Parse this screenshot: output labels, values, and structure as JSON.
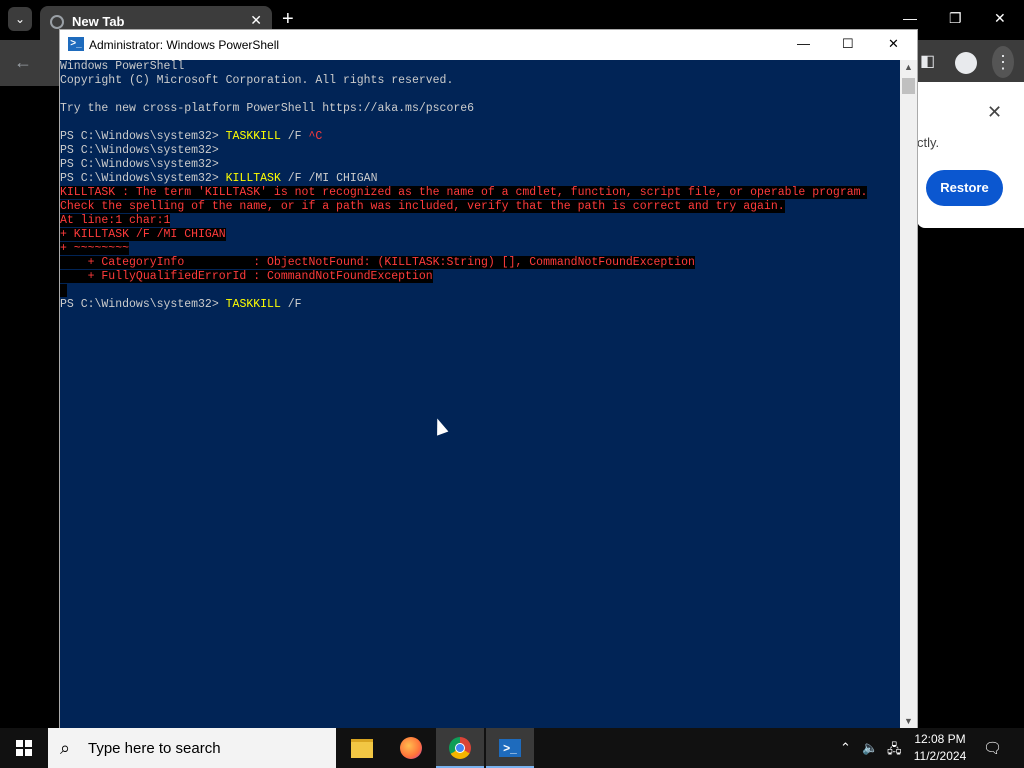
{
  "chrome": {
    "tab_title": "New Tab",
    "tab_close": "✕",
    "new_tab": "+",
    "minimize": "—",
    "restore": "❐",
    "close": "✕",
    "bubble_text": "ctly.",
    "bubble_close": "✕",
    "restore_button": "Restore"
  },
  "powershell": {
    "window_title": "Administrator: Windows PowerShell",
    "lines": [
      {
        "type": "plain",
        "text": "Windows PowerShell"
      },
      {
        "type": "plain",
        "text": "Copyright (C) Microsoft Corporation. All rights reserved."
      },
      {
        "type": "plain",
        "text": ""
      },
      {
        "type": "plain",
        "text": "Try the new cross-platform PowerShell https://aka.ms/pscore6"
      },
      {
        "type": "plain",
        "text": ""
      },
      {
        "type": "prompt",
        "prompt": "PS C:\\Windows\\system32> ",
        "cmd": "TASKKILL",
        "args": " /F ",
        "extra": "^C"
      },
      {
        "type": "prompt",
        "prompt": "PS C:\\Windows\\system32> ",
        "cmd": "",
        "args": "",
        "extra": ""
      },
      {
        "type": "prompt",
        "prompt": "PS C:\\Windows\\system32> ",
        "cmd": "",
        "args": "",
        "extra": ""
      },
      {
        "type": "prompt",
        "prompt": "PS C:\\Windows\\system32> ",
        "cmd": "KILLTASK",
        "args": " /F /MI CHIGAN",
        "extra": ""
      },
      {
        "type": "error",
        "text": "KILLTASK : The term 'KILLTASK' is not recognized as the name of a cmdlet, function, script file, or operable program."
      },
      {
        "type": "error",
        "text": "Check the spelling of the name, or if a path was included, verify that the path is correct and try again."
      },
      {
        "type": "error",
        "text": "At line:1 char:1"
      },
      {
        "type": "error",
        "text": "+ KILLTASK /F /MI CHIGAN"
      },
      {
        "type": "error",
        "text": "+ ~~~~~~~~"
      },
      {
        "type": "error",
        "text": "    + CategoryInfo          : ObjectNotFound: (KILLTASK:String) [], CommandNotFoundException"
      },
      {
        "type": "error",
        "text": "    + FullyQualifiedErrorId : CommandNotFoundException"
      },
      {
        "type": "error",
        "text": " "
      },
      {
        "type": "prompt",
        "prompt": "PS C:\\Windows\\system32> ",
        "cmd": "TASKKILL",
        "args": " /F",
        "extra": ""
      }
    ]
  },
  "taskbar": {
    "search_placeholder": "Type here to search",
    "clock_time": "12:08 PM",
    "clock_date": "11/2/2024"
  }
}
